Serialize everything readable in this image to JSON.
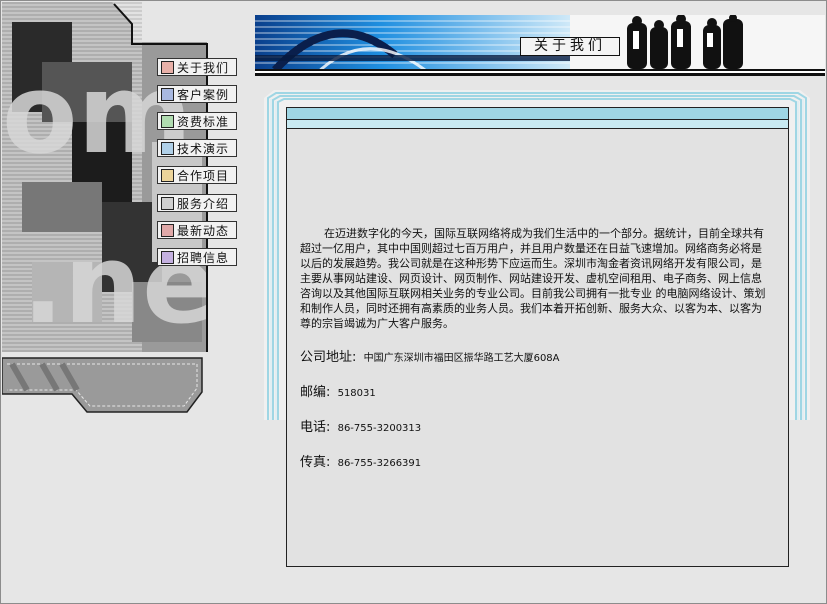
{
  "header": {
    "title": "关于我们"
  },
  "nav": {
    "items": [
      {
        "label": "关于我们",
        "icon": "about-icon",
        "color": "#c0392b"
      },
      {
        "label": "客户案例",
        "icon": "cases-icon",
        "color": "#3a5fb0"
      },
      {
        "label": "资费标准",
        "icon": "pricing-icon",
        "color": "#3f9a3f"
      },
      {
        "label": "技术演示",
        "icon": "demo-icon",
        "color": "#3a7fb0"
      },
      {
        "label": "合作项目",
        "icon": "partner-icon",
        "color": "#c89a2a"
      },
      {
        "label": "服务介绍",
        "icon": "service-icon",
        "color": "#555555"
      },
      {
        "label": "最新动态",
        "icon": "news-icon",
        "color": "#a03030"
      },
      {
        "label": "招聘信息",
        "icon": "jobs-icon",
        "color": "#6a3fa0"
      }
    ]
  },
  "content": {
    "intro": "在迈进数字化的今天，国际互联网络将成为我们生活中的一个部分。据统计，目前全球共有超过一亿用户，其中中国则超过七百万用户，并且用户数量还在日益飞速增加。网络商务必将是以后的发展趋势。我公司就是在这种形势下应运而生。深圳市淘金者资讯网络开发有限公司，是主要从事网站建设、网页设计、网页制作、网站建设开发、虚机空间租用、电子商务、网上信息咨询以及其他国际互联网相关业务的专业公司。目前我公司拥有一批专业 的电脑网络设计、策划和制作人员，同时还拥有高素质的业务人员。我们本着开拓创新、服务大众、以客为本、以客为尊的宗旨竭诚为广大客户服务。",
    "address_label": "公司地址:",
    "address_value": "中国广东深圳市福田区振华路工艺大厦608A",
    "postcode_label": "邮编:",
    "postcode_value": "518031",
    "phone_label": "电话:",
    "phone_value": "86-755-3200313",
    "fax_label": "传真:",
    "fax_value": "86-755-3266391"
  },
  "decor": {
    "left_art_text": ".com .net"
  },
  "colors": {
    "accent_blue": "#1a7fd0",
    "frame_cyan": "#9fd6e4",
    "page_bg": "#e6e6e6"
  }
}
